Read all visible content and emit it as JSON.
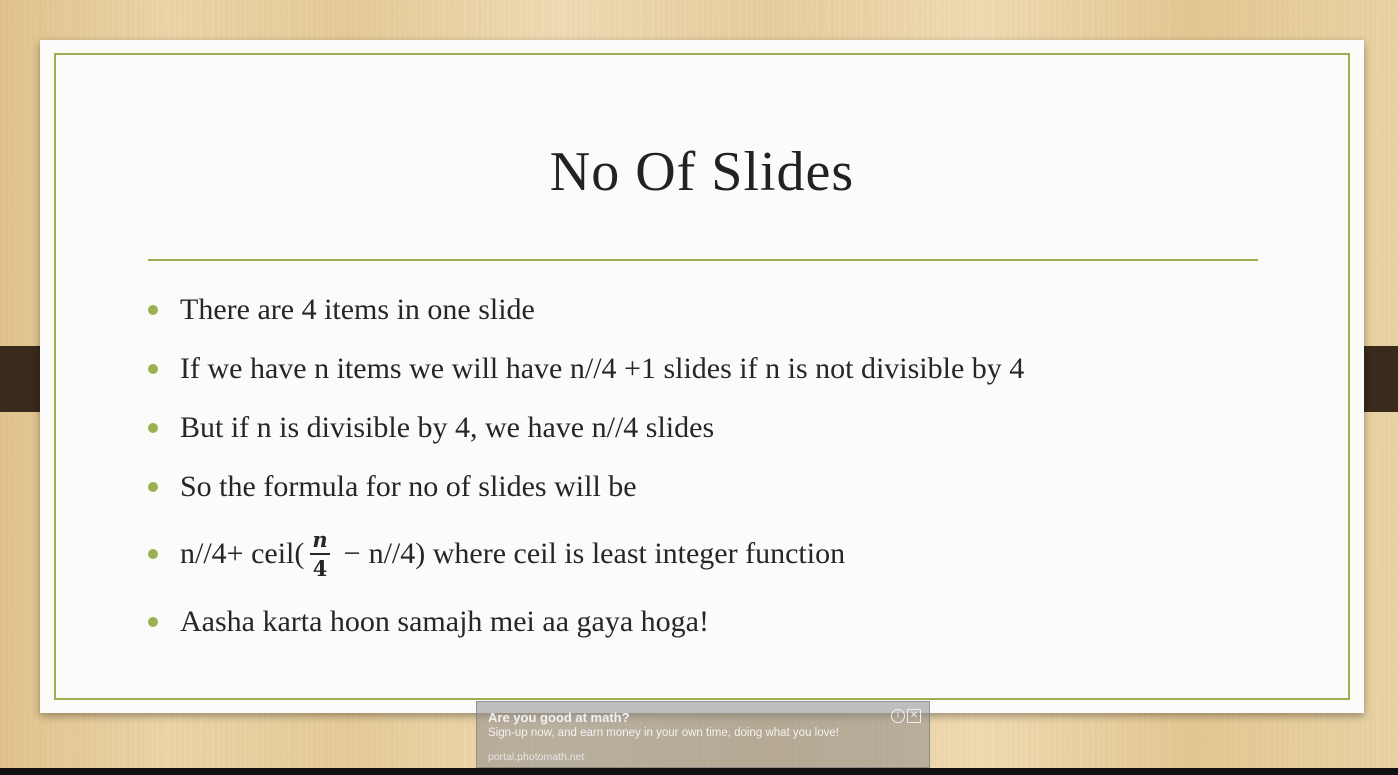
{
  "slide": {
    "title": "No Of Slides",
    "bullets": [
      "There are 4 items in one slide",
      "If  we have n items we will have n//4 +1 slides if  n is not divisible by 4",
      "But if  n is divisible by 4, we have n//4 slides",
      "So the formula for no of  slides will be"
    ],
    "formula": {
      "prefix": "n//4+ ceil(",
      "numerator": "n",
      "denominator": "4",
      "minus": "−",
      "suffix": "n//4) where ceil is least integer function"
    },
    "last_bullet": "Aasha karta hoon samajh mei aa gaya hoga!",
    "accent_color": "#9bb050"
  },
  "ad": {
    "title": "Are you good at math?",
    "body": "Sign-up now, and earn money in your own time, doing what you love!",
    "url": "portal.photomath.net",
    "info_icon_glyph": "i",
    "close_icon_glyph": "✕"
  }
}
